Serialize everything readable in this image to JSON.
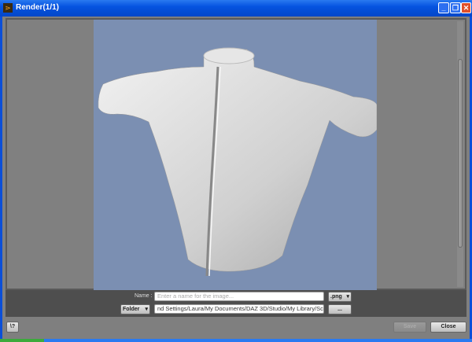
{
  "window": {
    "title": "Render(1/1)",
    "minimize": "_",
    "maximize": "❐",
    "close": "✕"
  },
  "controls": {
    "name_label": "Name :",
    "name_placeholder": "Enter a name for the image...",
    "format": ".png",
    "folder_label": "Folder",
    "path": "nd Settings/Laura/My Documents/DAZ 3D/Studio/My Library/Scenes",
    "browse": "..."
  },
  "footer": {
    "help": "\\?",
    "save": "Save",
    "close": "Close"
  },
  "colors": {
    "render_bg": "#7b8fb2",
    "panel": "#808080"
  }
}
